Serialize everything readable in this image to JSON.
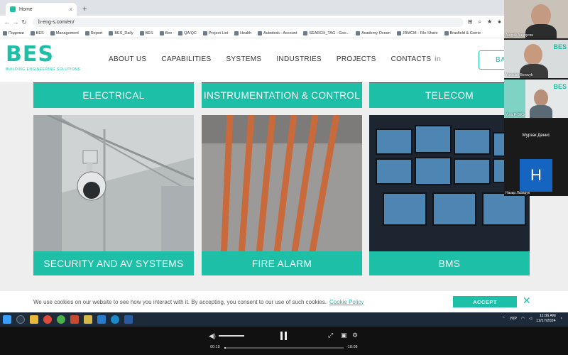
{
  "browser": {
    "tab_title": "Home",
    "tab_close": "×",
    "new_tab": "+",
    "back": "←",
    "forward": "→",
    "reload": "↻",
    "url": "b-eng-s.com/en/",
    "bookmarks": [
      "Поделки",
      "BES",
      "Management",
      "Report",
      "BES_Daily",
      "BES",
      "Box",
      "QA/QC",
      "Project List",
      "Health",
      "Autodesk - Account",
      "SEARCH_TAG - Goo...",
      "Academy Ocean",
      "JRMCM - File Share",
      "Brasfield & Gorrie"
    ]
  },
  "site": {
    "logo": "BES",
    "logo_subtitle": "BUILDING ENGINEERING SOLUTIONS",
    "nav": [
      "ABOUT US",
      "CAPABILITIES",
      "SYSTEMS",
      "INDUSTRIES",
      "PROJECTS",
      "CONTACTS"
    ],
    "linkedin": "in",
    "cta": "BAC"
  },
  "cards_row1": [
    "ELECTRICAL",
    "INSTRUMENTATION & CONTROL",
    "TELECOM"
  ],
  "cards_row2": [
    "SECURITY AND AV SYSTEMS",
    "FIRE ALARM",
    "BMS"
  ],
  "cookie": {
    "text": "We use cookies on our website to see how you interact with it. By accepting, you consent to our use of such cookies.",
    "link": "Cookie Policy",
    "accept": "ACCEPT",
    "close": "✕"
  },
  "participants": [
    {
      "name": "Андрій Андрусяк"
    },
    {
      "name": "Yaroslav Borovyk"
    },
    {
      "name": "Yura P-BES"
    },
    {
      "name": "Мурзак Денис"
    },
    {
      "name": "Назар Лазарук",
      "initial": "H"
    }
  ],
  "watermark": "BES",
  "taskbar": {
    "lang": "УКР",
    "time": "11:06 AM",
    "date": "12/17/2024"
  },
  "player": {
    "elapsed": "00:15",
    "remaining": "-18:08",
    "progress_pct": 1.4
  },
  "colors": {
    "accent": "#1dbfa6"
  }
}
